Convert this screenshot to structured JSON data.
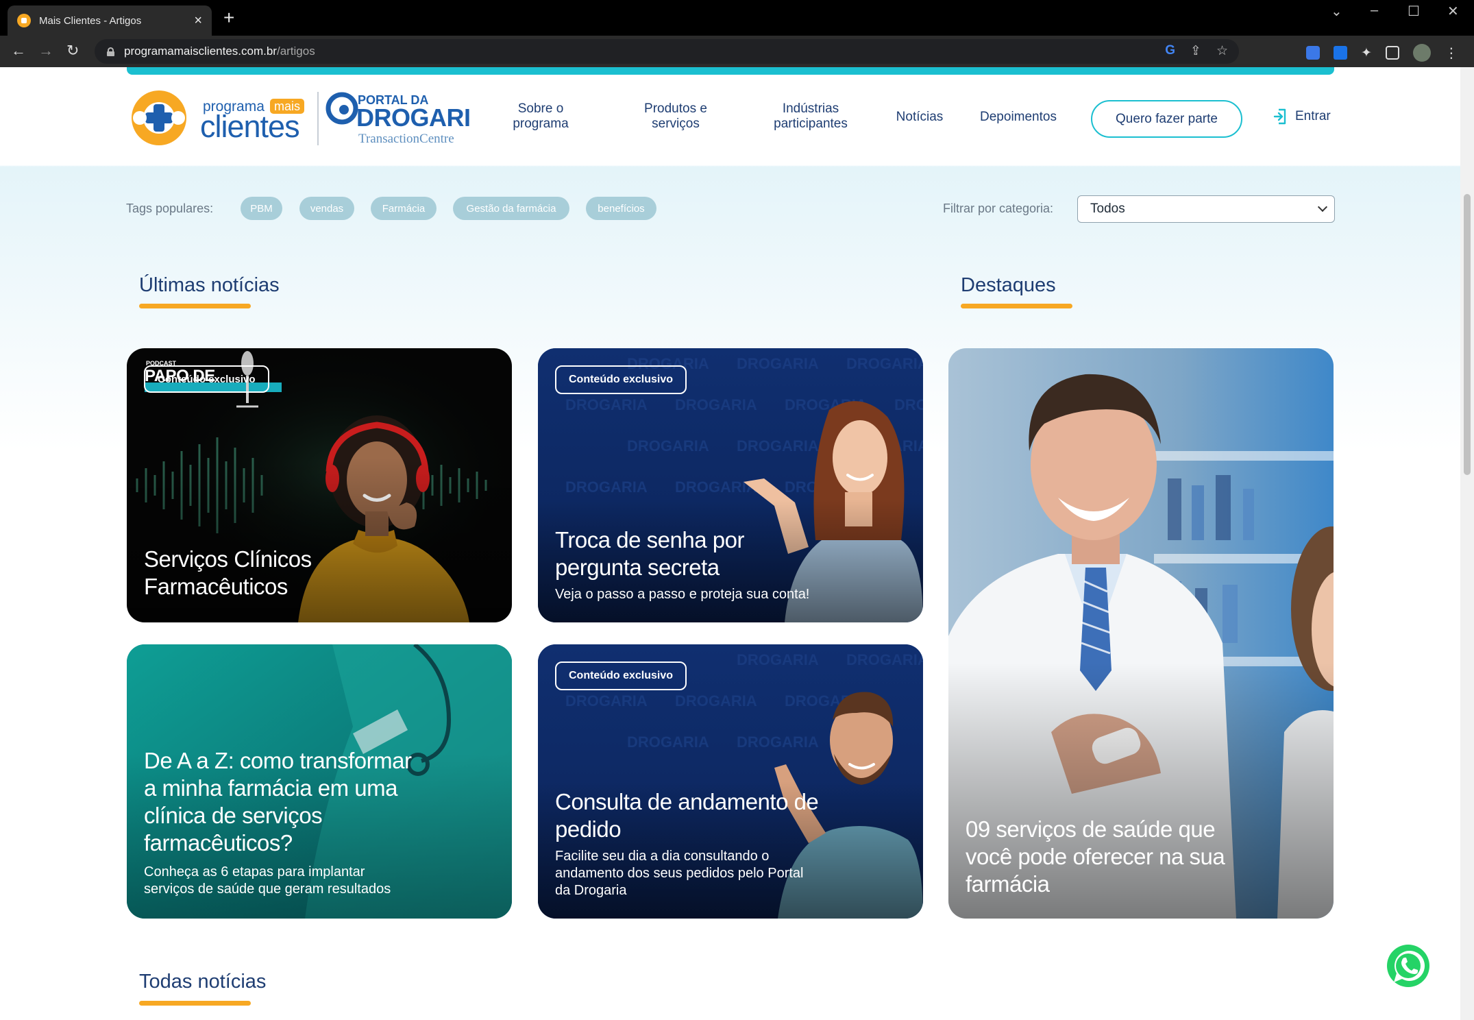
{
  "browser": {
    "tab_title": "Mais Clientes - Artigos",
    "url_host": "programamaisclientes.com.br",
    "url_path": "/artigos"
  },
  "header": {
    "nav": [
      {
        "label": "Sobre o\nprograma"
      },
      {
        "label": "Produtos e\nserviços"
      },
      {
        "label": "Indústrias\nparticipantes"
      },
      {
        "label": "Notícias"
      },
      {
        "label": "Depoimentos"
      }
    ],
    "cta_label": "Quero fazer parte",
    "login_label": "Entrar"
  },
  "filters": {
    "tags_label": "Tags populares:",
    "tags": [
      "PBM",
      "vendas",
      "Farmácia",
      "Gestão da farmácia",
      "benefícios"
    ],
    "category_label": "Filtrar por categoria:",
    "category_value": "Todos"
  },
  "latest": {
    "title": "Últimas notícias",
    "cards": [
      {
        "title": "Serviços Clínicos\nFarmacêuticos",
        "subtitle": "",
        "badge": "Conteúdo exclusivo",
        "podcast_small": "PODCAST",
        "podcast_big": "PAPO DE"
      },
      {
        "title": "Troca de senha por\npergunta secreta",
        "subtitle": "Veja o passo a passo e proteja sua conta!",
        "badge": "Conteúdo exclusivo"
      },
      {
        "title": "De A a Z: como transformar\na minha farmácia em uma\nclínica de serviços\nfarmacêuticos?",
        "subtitle": "Conheça as 6 etapas para implantar\nserviços de saúde que geram resultados",
        "badge": ""
      },
      {
        "title": "Consulta de andamento de\npedido",
        "subtitle": "Facilite seu dia a dia consultando o\nandamento dos seus pedidos pelo Portal\nda Drogaria",
        "badge": "Conteúdo exclusivo"
      }
    ]
  },
  "highlights": {
    "title": "Destaques",
    "card": {
      "title": "09 serviços de saúde que\nvocê pode oferecer na sua\nfarmácia"
    }
  },
  "all_news": {
    "title": "Todas notícias"
  },
  "logos": {
    "brand1_top": "programa",
    "brand1_badge": "mais",
    "brand1_main": "clientes",
    "brand2_top": "PORTAL DA",
    "brand2_main": "DROGARIA",
    "brand2_sub": "TransactionCentre"
  },
  "watermark_text": "DROGARIA",
  "colors": {
    "accent_orange": "#f7a823",
    "accent_cyan": "#1bbfd0",
    "navy": "#1e3d72"
  }
}
